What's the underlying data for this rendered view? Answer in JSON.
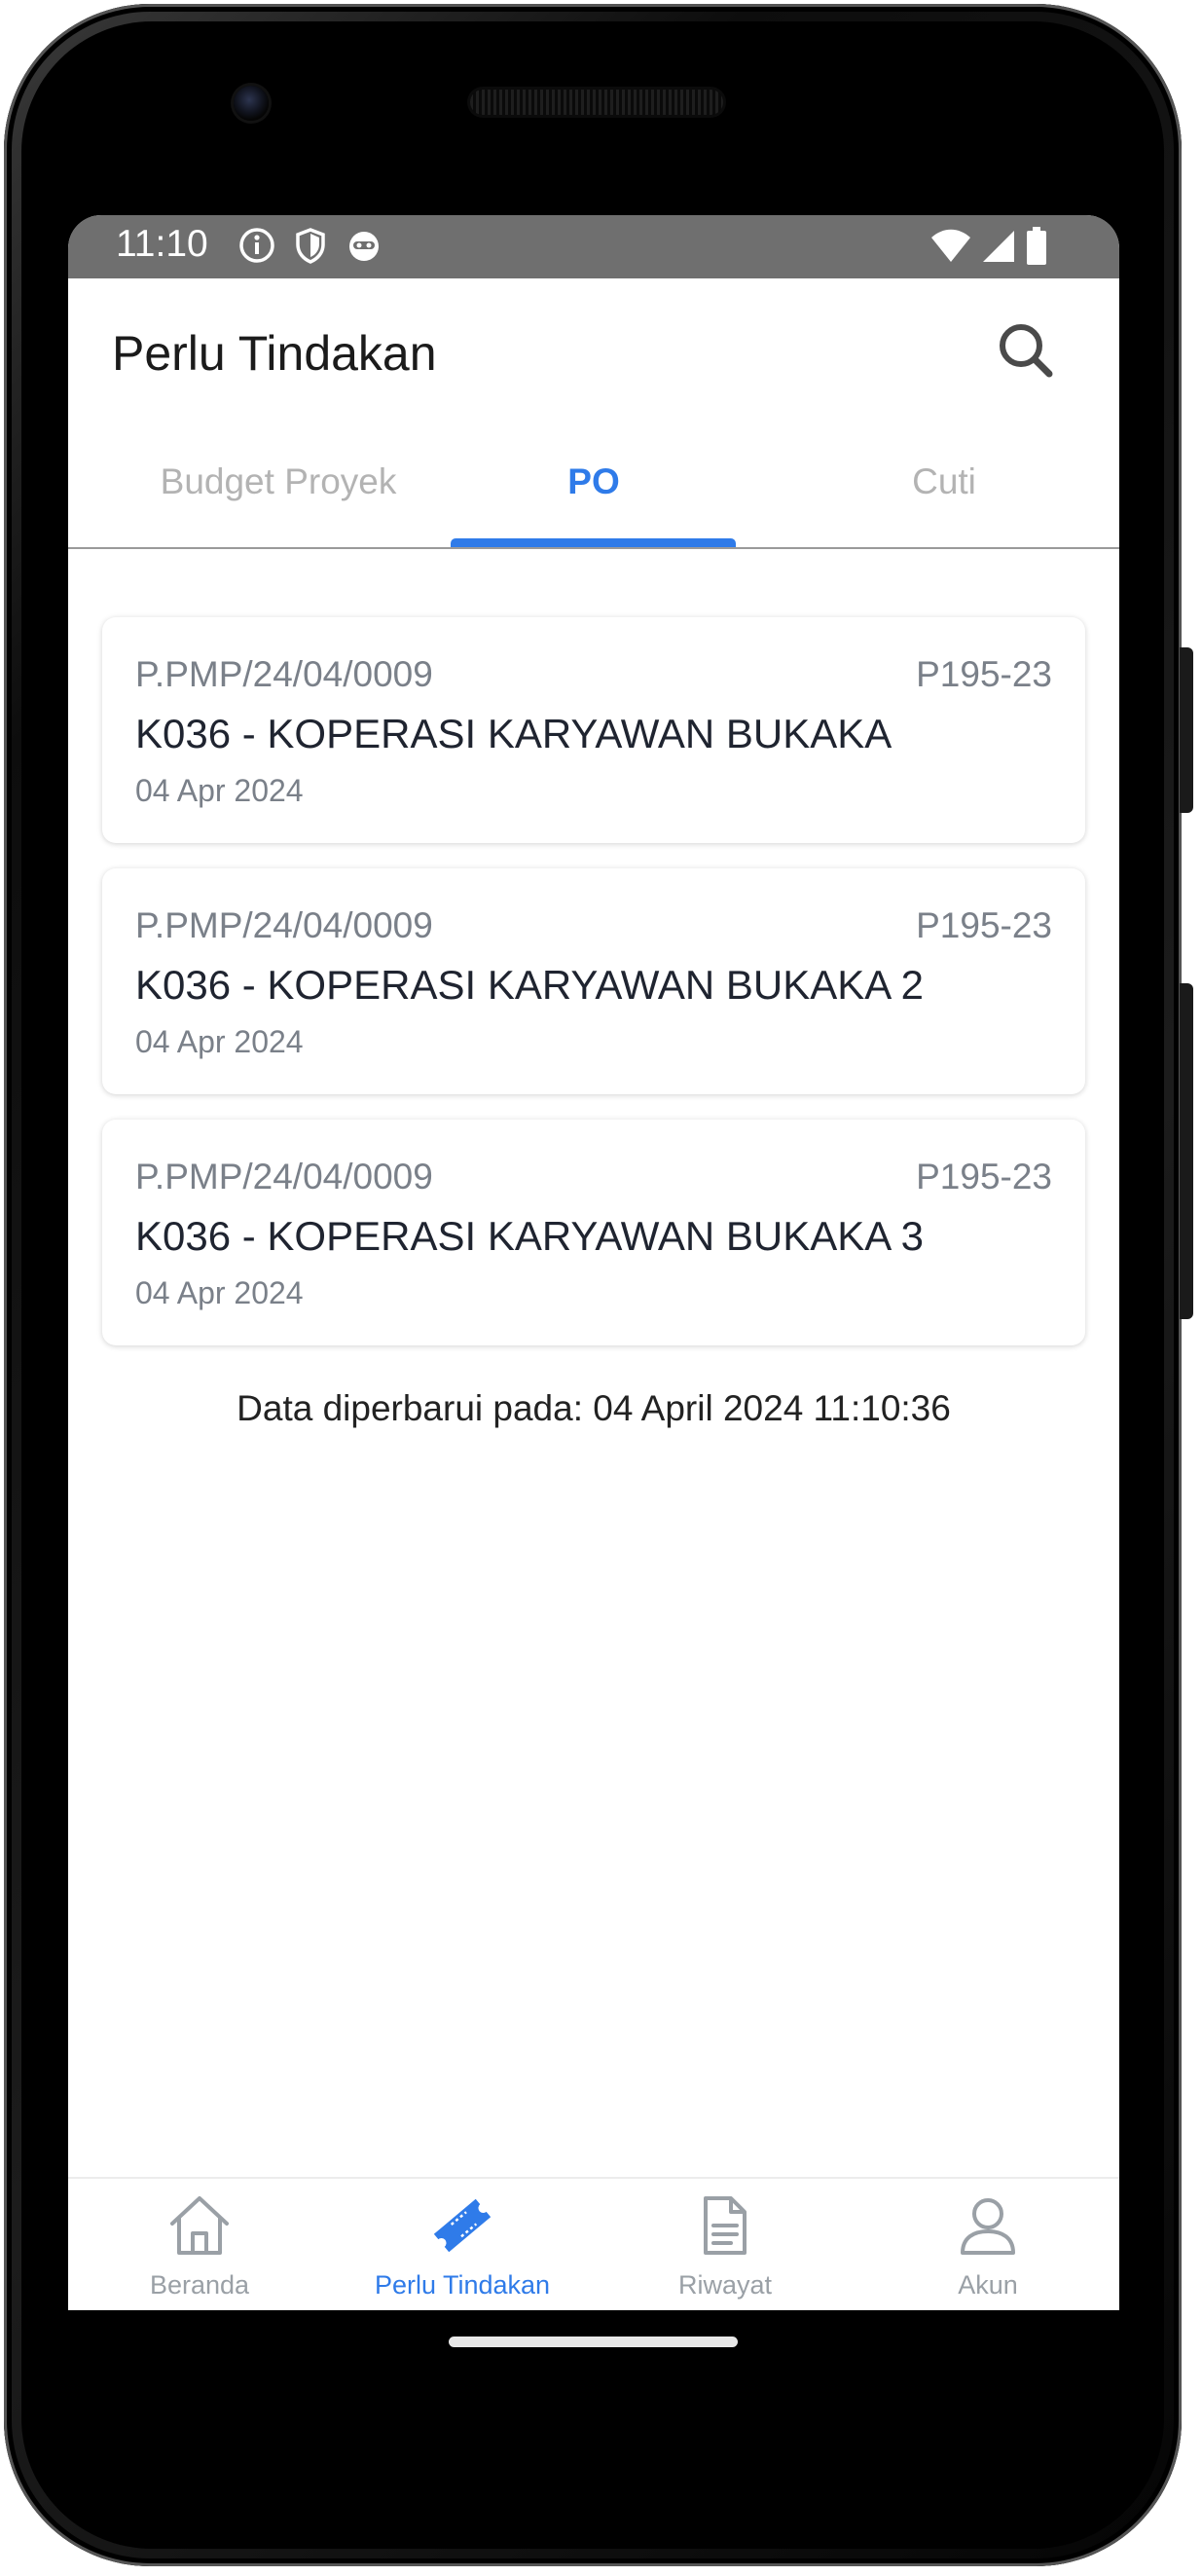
{
  "status_bar": {
    "time": "11:10",
    "left_icons": [
      "info-icon",
      "shield-icon",
      "cat-face-icon"
    ],
    "right_icons": [
      "wifi-icon",
      "cell-signal-icon",
      "battery-icon"
    ]
  },
  "header": {
    "title": "Perlu Tindakan",
    "search_icon": "search-icon"
  },
  "tabs": [
    {
      "label": "Budget Proyek",
      "active": false
    },
    {
      "label": "PO",
      "active": true
    },
    {
      "label": "Cuti",
      "active": false
    }
  ],
  "items": [
    {
      "ref": "P.PMP/24/04/0009",
      "code": "P195-23",
      "title": "K036 - KOPERASI KARYAWAN BUKAKA",
      "date": "04 Apr 2024"
    },
    {
      "ref": "P.PMP/24/04/0009",
      "code": "P195-23",
      "title": "K036 - KOPERASI KARYAWAN BUKAKA 2",
      "date": "04 Apr 2024"
    },
    {
      "ref": "P.PMP/24/04/0009",
      "code": "P195-23",
      "title": "K036 - KOPERASI KARYAWAN BUKAKA 3",
      "date": "04 Apr 2024"
    }
  ],
  "updated_text": "Data diperbarui pada: 04 April 2024 11:10:36",
  "bottom_nav": [
    {
      "label": "Beranda",
      "icon": "home-icon",
      "active": false
    },
    {
      "label": "Perlu Tindakan",
      "icon": "ticket-icon",
      "active": true
    },
    {
      "label": "Riwayat",
      "icon": "document-icon",
      "active": false
    },
    {
      "label": "Akun",
      "icon": "user-icon",
      "active": false
    }
  ],
  "colors": {
    "accent": "#2f7be9",
    "status_bar": "#6f6f6f",
    "muted": "#7a8089"
  }
}
